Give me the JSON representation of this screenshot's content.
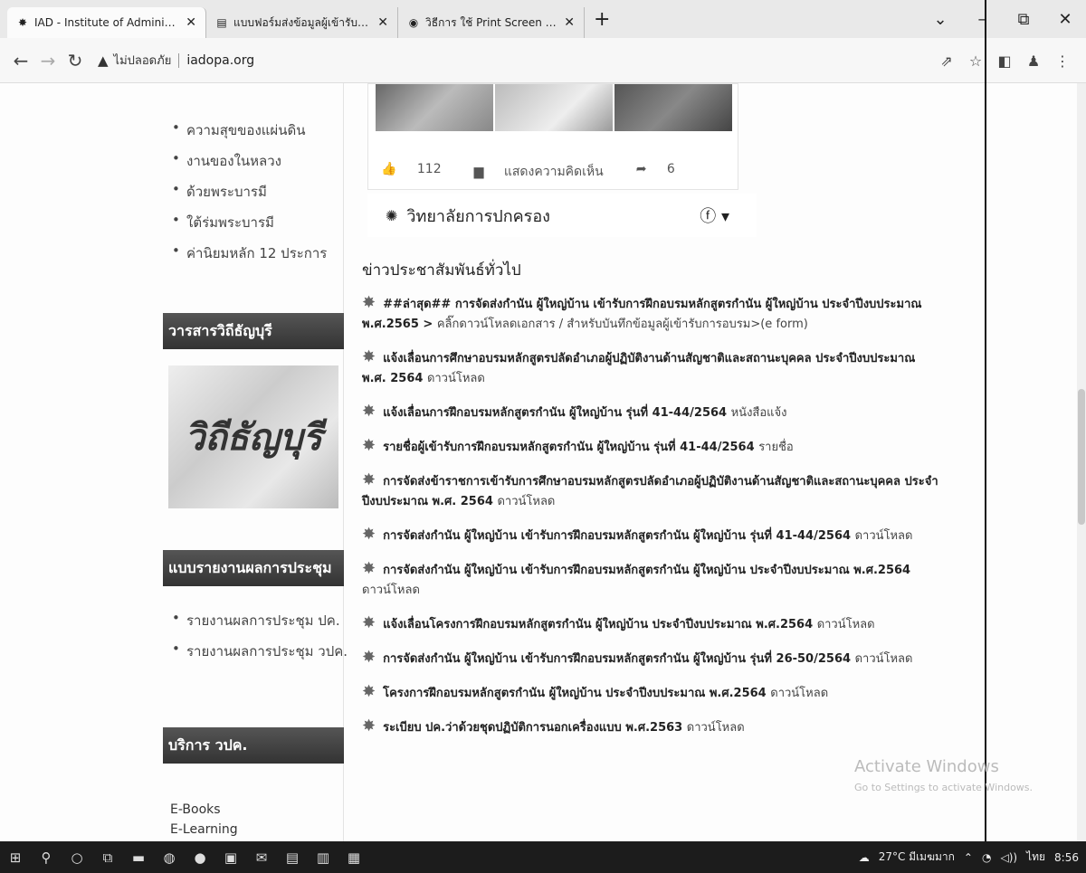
{
  "browser": {
    "tabs": [
      {
        "label": "IAD - Institute of Administration",
        "icon": "sun-emblem-icon",
        "active": true
      },
      {
        "label": "แบบฟอร์มส่งข้อมูลผู้เข้ารับการฝึกอบรม",
        "icon": "sheet-icon",
        "active": false
      },
      {
        "label": "วิธีการ ใช้ Print Screen (แคปหน้าจอ",
        "icon": "globe-icon",
        "active": false
      }
    ],
    "new_tab": "+",
    "security_label": "ไม่ปลอดภัย",
    "url": "iadopa.org"
  },
  "sidebar": {
    "list1": [
      "ความสุขของแผ่นดิน",
      "งานของในหลวง",
      "ด้วยพระบารมี",
      "ใต้ร่มพระบารมี",
      "ค่านิยมหลัก 12 ประการ"
    ],
    "header_journal": "วารสารวิถีธัญบุรี",
    "banner_text": "วิถีธัญบุรี",
    "header_report": "แบบรายงานผลการประชุม",
    "list2": [
      "รายงานผลการประชุม ปค.",
      "รายงานผลการประชุม วปค."
    ],
    "header_services": "บริการ วปค.",
    "links": [
      "E-Books",
      "E-Learning"
    ]
  },
  "post": {
    "likes": "112",
    "comments": "แสดงความคิดเห็น",
    "shares": "6"
  },
  "page_card": {
    "name": "วิทยาลัยการปกครอง"
  },
  "news": {
    "title": "ข่าวประชาสัมพันธ์ทั่วไป",
    "items": [
      {
        "text": "##ล่าสุด## การจัดส่งกำนัน ผู้ใหญ่บ้าน เข้ารับการฝึกอบรมหลักสูตรกำนัน ผู้ใหญ่บ้าน ประจำปีงบประมาณ พ.ศ.2565 >",
        "link": "คลิ๊กดาวน์โหลดเอกสาร / สำหรับบันทึกข้อมูลผู้เข้ารับการอบรม>(e form)"
      },
      {
        "text": "แจ้งเลื่อนการศึกษาอบรมหลักสูตรปลัดอำเภอผู้ปฏิบัติงานด้านสัญชาติและสถานะบุคคล ประจำปีงบประมาณ พ.ศ. 2564",
        "link": "ดาวน์โหลด"
      },
      {
        "text": "แจ้งเลื่อนการฝึกอบรมหลักสูตรกำนัน ผู้ใหญ่บ้าน รุ่นที่ 41-44/2564",
        "link": "หนังสือแจ้ง"
      },
      {
        "text": "รายชื่อผู้เข้ารับการฝึกอบรมหลักสูตรกำนัน ผู้ใหญ่บ้าน รุ่นที่ 41-44/2564",
        "link": "รายชื่อ"
      },
      {
        "text": "การจัดส่งข้าราชการเข้ารับการศึกษาอบรมหลักสูตรปลัดอำเภอผู้ปฏิบัติงานด้านสัญชาติและสถานะบุคคล ประจำปีงบประมาณ พ.ศ. 2564",
        "link": "ดาวน์โหลด"
      },
      {
        "text": "การจัดส่งกำนัน ผู้ใหญ่บ้าน เข้ารับการฝึกอบรมหลักสูตรกำนัน ผู้ใหญ่บ้าน รุ่นที่ 41-44/2564",
        "link": "ดาวน์โหลด"
      },
      {
        "text": "การจัดส่งกำนัน ผู้ใหญ่บ้าน เข้ารับการฝึกอบรมหลักสูตรกำนัน ผู้ใหญ่บ้าน ประจำปีงบประมาณ พ.ศ.2564",
        "link": "ดาวน์โหลด"
      },
      {
        "text": "แจ้งเลื่อนโครงการฝึกอบรมหลักสูตรกำนัน ผู้ใหญ่บ้าน ประจำปีงบประมาณ พ.ศ.2564",
        "link": "ดาวน์โหลด"
      },
      {
        "text": "การจัดส่งกำนัน ผู้ใหญ่บ้าน เข้ารับการฝึกอบรมหลักสูตรกำนัน ผู้ใหญ่บ้าน รุ่นที่ 26-50/2564",
        "link": "ดาวน์โหลด"
      },
      {
        "text": "โครงการฝึกอบรมหลักสูตรกำนัน ผู้ใหญ่บ้าน ประจำปีงบประมาณ พ.ศ.2564",
        "link": "ดาวน์โหลด"
      },
      {
        "text": "ระเบียบ ปค.ว่าด้วยชุดปฏิบัติการนอกเครื่องแบบ พ.ศ.2563",
        "link": "ดาวน์โหลด"
      }
    ]
  },
  "watermark": {
    "line1": "Activate Windows",
    "line2": "Go to Settings to activate Windows."
  },
  "taskbar": {
    "weather": "27°C มีเมฆมาก",
    "lang": "ไทย",
    "time": "8:56"
  }
}
